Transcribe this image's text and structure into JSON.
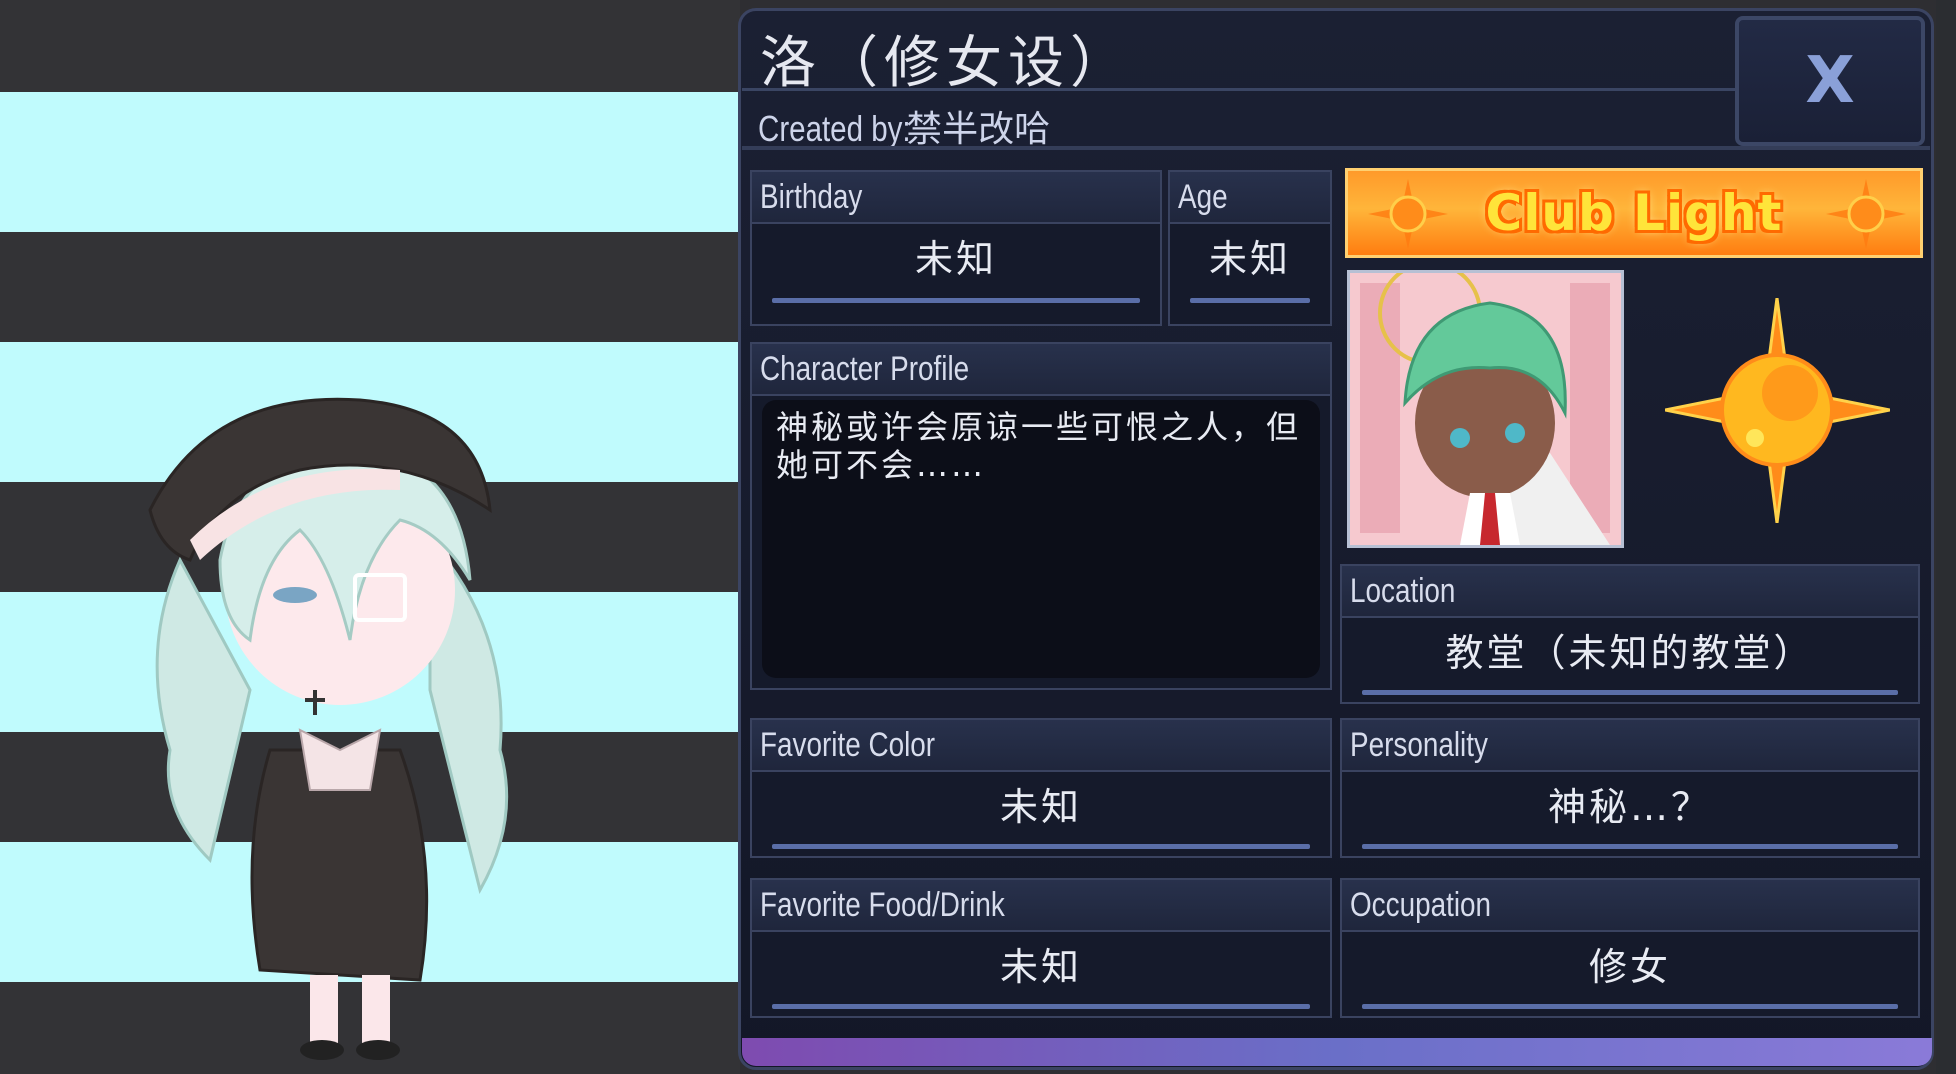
{
  "character": {
    "name": "洛（修女设）",
    "created_by_label": "Created by:",
    "creator": "禁半改哈"
  },
  "close_button": {
    "label": "X"
  },
  "fields": {
    "birthday": {
      "label": "Birthday",
      "value": "未知"
    },
    "age": {
      "label": "Age",
      "value": "未知"
    },
    "profile": {
      "label": "Character Profile",
      "value": "神秘或许会原谅一些可恨之人，但她可不会……"
    },
    "location": {
      "label": "Location",
      "value": "教堂（未知的教堂）"
    },
    "favorite_color": {
      "label": "Favorite Color",
      "value": "未知"
    },
    "personality": {
      "label": "Personality",
      "value": "神秘…？"
    },
    "favorite_food": {
      "label": "Favorite Food/Drink",
      "value": "未知"
    },
    "occupation": {
      "label": "Occupation",
      "value": "修女"
    }
  },
  "club": {
    "name": "Club Light",
    "icon": "sun-icon"
  },
  "colors": {
    "panel_bg": "#1b2033",
    "panel_border": "#3b4462",
    "stripe_light": "#c0fbfd",
    "stripe_dark": "#333336",
    "club_orange": "#ff9a2a",
    "club_text": "#ffe43a"
  }
}
